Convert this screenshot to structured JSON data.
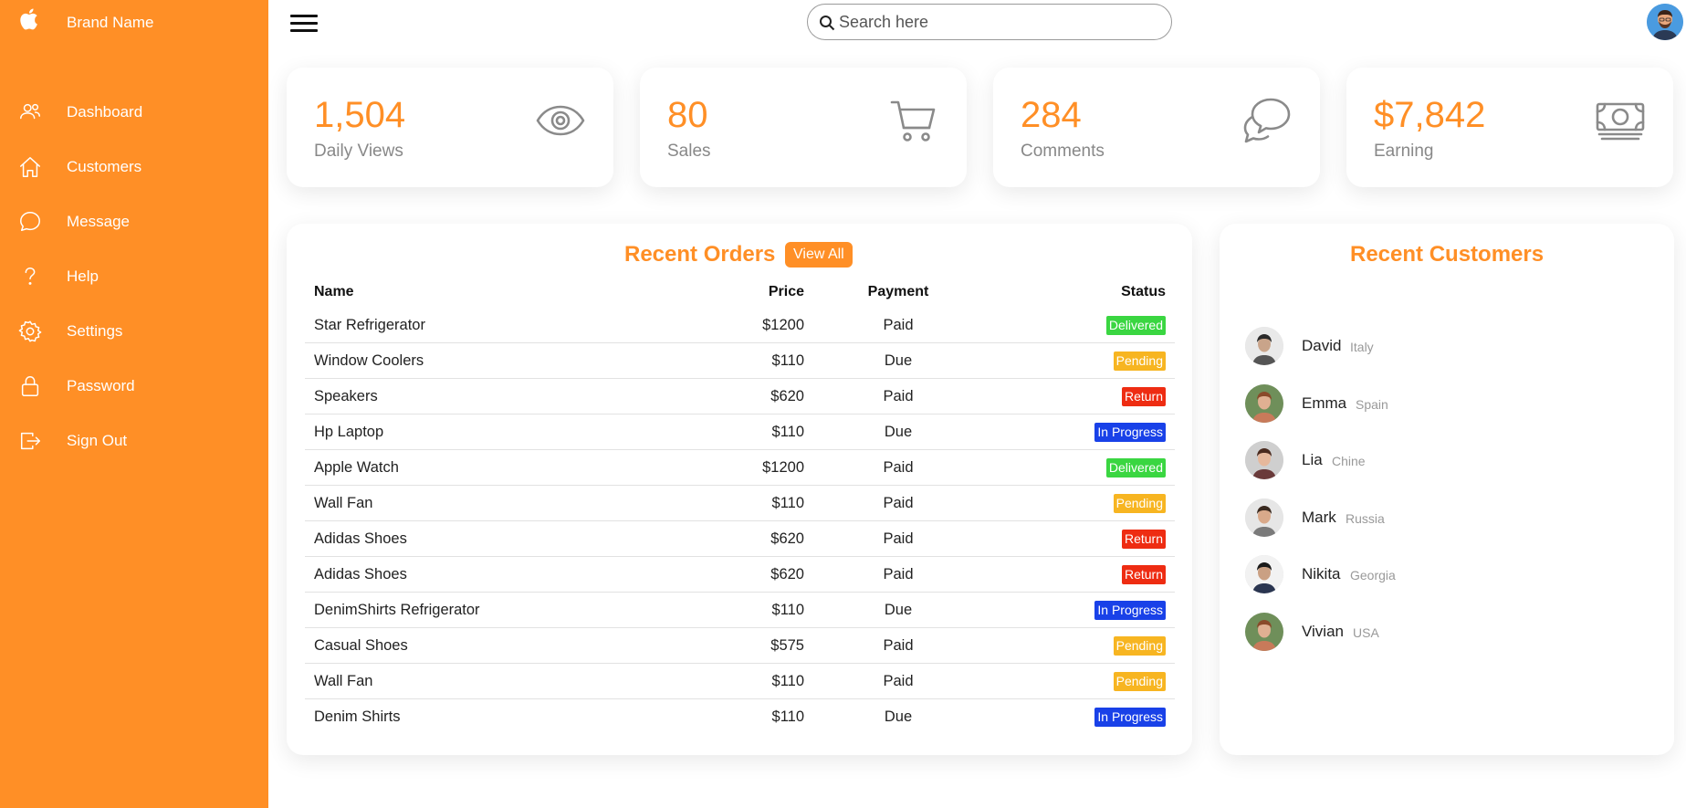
{
  "brand": {
    "name": "Brand Name",
    "icon": "apple-icon"
  },
  "sidebar": {
    "items": [
      {
        "label": "Dashboard",
        "icon": "users-icon"
      },
      {
        "label": "Customers",
        "icon": "home-icon"
      },
      {
        "label": "Message",
        "icon": "chat-icon"
      },
      {
        "label": "Help",
        "icon": "help-icon"
      },
      {
        "label": "Settings",
        "icon": "gear-icon"
      },
      {
        "label": "Password",
        "icon": "lock-icon"
      },
      {
        "label": "Sign Out",
        "icon": "sign-out-icon"
      }
    ]
  },
  "search": {
    "placeholder": "Search here",
    "value": ""
  },
  "cards": [
    {
      "value": "1,504",
      "label": "Daily Views",
      "icon": "eye-icon"
    },
    {
      "value": "80",
      "label": "Sales",
      "icon": "cart-icon"
    },
    {
      "value": "284",
      "label": "Comments",
      "icon": "chat-bubbles-icon"
    },
    {
      "value": "$7,842",
      "label": "Earning",
      "icon": "cash-icon"
    }
  ],
  "orders": {
    "title": "Recent Orders",
    "view_all": "View All",
    "headers": {
      "name": "Name",
      "price": "Price",
      "payment": "Payment",
      "status": "Status"
    },
    "rows": [
      {
        "name": "Star Refrigerator",
        "price": "$1200",
        "payment": "Paid",
        "status": "Delivered"
      },
      {
        "name": "Window Coolers",
        "price": "$110",
        "payment": "Due",
        "status": "Pending"
      },
      {
        "name": "Speakers",
        "price": "$620",
        "payment": "Paid",
        "status": "Return"
      },
      {
        "name": "Hp Laptop",
        "price": "$110",
        "payment": "Due",
        "status": "In Progress"
      },
      {
        "name": "Apple Watch",
        "price": "$1200",
        "payment": "Paid",
        "status": "Delivered"
      },
      {
        "name": "Wall Fan",
        "price": "$110",
        "payment": "Paid",
        "status": "Pending"
      },
      {
        "name": "Adidas Shoes",
        "price": "$620",
        "payment": "Paid",
        "status": "Return"
      },
      {
        "name": "Adidas Shoes",
        "price": "$620",
        "payment": "Paid",
        "status": "Return"
      },
      {
        "name": "DenimShirts Refrigerator",
        "price": "$110",
        "payment": "Due",
        "status": "In Progress"
      },
      {
        "name": "Casual Shoes",
        "price": "$575",
        "payment": "Paid",
        "status": "Pending"
      },
      {
        "name": "Wall Fan",
        "price": "$110",
        "payment": "Paid",
        "status": "Pending"
      },
      {
        "name": "Denim Shirts",
        "price": "$110",
        "payment": "Due",
        "status": "In Progress"
      }
    ]
  },
  "status_colors": {
    "Delivered": "#3ad641",
    "Pending": "#f7b521",
    "Return": "#ee2c12",
    "In Progress": "#1941e8"
  },
  "customers": {
    "title": "Recent Customers",
    "list": [
      {
        "name": "David",
        "country": "Italy"
      },
      {
        "name": "Emma",
        "country": "Spain"
      },
      {
        "name": "Lia",
        "country": "Chine"
      },
      {
        "name": "Mark",
        "country": "Russia"
      },
      {
        "name": "Nikita",
        "country": "Georgia"
      },
      {
        "name": "Vivian",
        "country": "USA"
      }
    ]
  },
  "colors": {
    "accent": "#ff8f26",
    "muted": "#888888"
  }
}
